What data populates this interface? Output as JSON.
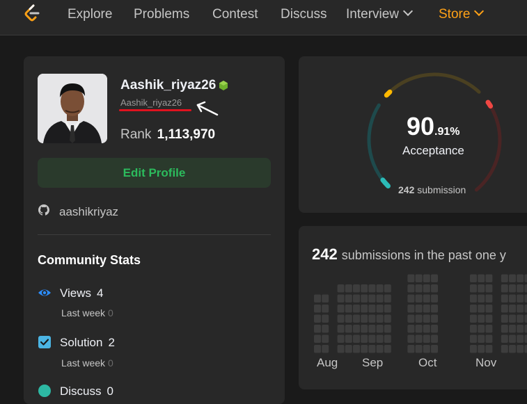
{
  "nav": {
    "items": [
      {
        "label": "Explore"
      },
      {
        "label": "Problems"
      },
      {
        "label": "Contest"
      },
      {
        "label": "Discuss"
      },
      {
        "label": "Interview"
      },
      {
        "label": "Store"
      }
    ],
    "accent": "#ffa116"
  },
  "profile": {
    "username": "Aashik_riyaz26",
    "handle": "Aashik_riyaz26",
    "rank_label": "Rank",
    "rank_value": "1,113,970",
    "edit_label": "Edit Profile",
    "github": "aashikriyaz",
    "badge_color": "#6fb02d"
  },
  "community": {
    "title": "Community Stats",
    "stats": [
      {
        "label": "Views",
        "value": "4",
        "sub_label": "Last week",
        "sub_value": "0",
        "icon": "eye-icon",
        "color": "#2c8eff"
      },
      {
        "label": "Solution",
        "value": "2",
        "sub_label": "Last week",
        "sub_value": "0",
        "icon": "checkbox-icon",
        "color": "#4bb5e4"
      },
      {
        "label": "Discuss",
        "value": "0",
        "icon": "chat-icon",
        "color": "#2db8a3"
      }
    ]
  },
  "acceptance": {
    "int_part": "90",
    "dec_part": ".91%",
    "label": "Acceptance",
    "submissions_count": "242",
    "submissions_label": "submission",
    "rate": 0.9091
  },
  "heatmap": {
    "count": "242",
    "text": "submissions in the past one y",
    "months": [
      "Aug",
      "Sep",
      "Oct",
      "Nov"
    ]
  }
}
